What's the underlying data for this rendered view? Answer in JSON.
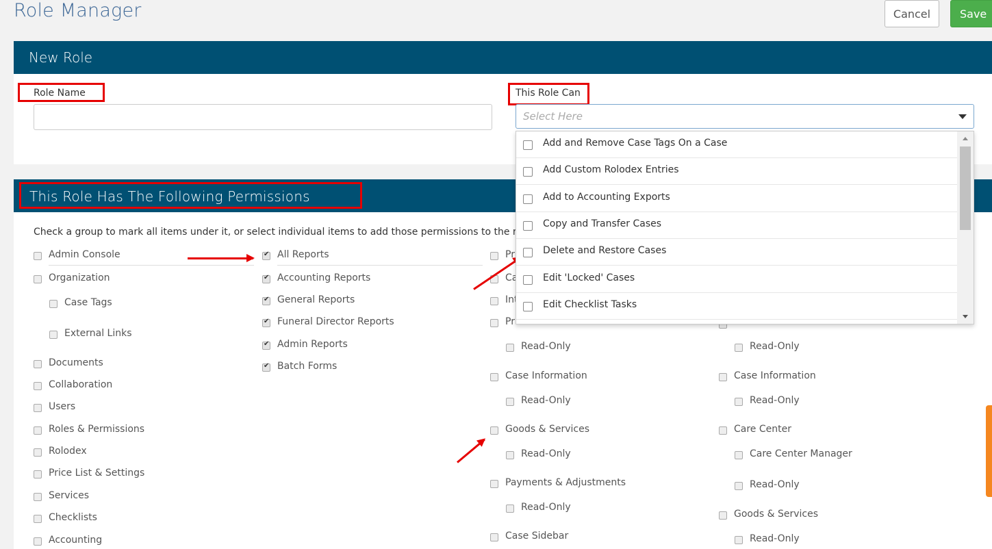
{
  "header": {
    "title": "Role Manager",
    "cancel_label": "Cancel",
    "save_label": "Save"
  },
  "new_role": {
    "heading": "New Role",
    "role_name_label": "Role Name",
    "role_name_value": "",
    "this_role_can_label": "This Role Can",
    "select_placeholder": "Select Here",
    "dropdown_options": [
      "Add and Remove Case Tags On a Case",
      "Add Custom Rolodex Entries",
      "Add to Accounting Exports",
      "Copy and Transfer Cases",
      "Delete and Restore Cases",
      "Edit 'Locked' Cases",
      "Edit Checklist Tasks"
    ]
  },
  "permissions": {
    "heading": "This Role Has The Following Permissions",
    "instructions": "Check a group to mark all items under it, or select individual items to add those permissions to the role.",
    "col1": [
      {
        "label": "Admin Console",
        "checked": false
      },
      {
        "label": "Organization",
        "checked": false
      },
      {
        "label": "Case Tags",
        "checked": false
      },
      {
        "label": "External Links",
        "checked": false
      },
      {
        "label": "Documents",
        "checked": false
      },
      {
        "label": "Collaboration",
        "checked": false
      },
      {
        "label": "Users",
        "checked": false
      },
      {
        "label": "Roles & Permissions",
        "checked": false
      },
      {
        "label": "Rolodex",
        "checked": false
      },
      {
        "label": "Price List & Settings",
        "checked": false
      },
      {
        "label": "Services",
        "checked": false
      },
      {
        "label": "Checklists",
        "checked": false
      },
      {
        "label": "Accounting",
        "checked": false
      }
    ],
    "col2": [
      {
        "label": "All Reports",
        "checked": true
      },
      {
        "label": "Accounting Reports",
        "checked": true
      },
      {
        "label": "General Reports",
        "checked": true
      },
      {
        "label": "Funeral Director Reports",
        "checked": true
      },
      {
        "label": "Admin Reports",
        "checked": true
      },
      {
        "label": "Batch Forms",
        "checked": true
      }
    ],
    "col3": [
      {
        "label": "Pr",
        "checked": false
      },
      {
        "label": "Ca",
        "checked": false
      },
      {
        "label": "Int",
        "checked": false
      },
      {
        "label": "Pr",
        "checked": false
      },
      {
        "label": "Read-Only",
        "checked": false
      },
      {
        "label": "Case Information",
        "checked": false
      },
      {
        "label": "Read-Only",
        "checked": false
      },
      {
        "label": "Goods & Services",
        "checked": false
      },
      {
        "label": "Read-Only",
        "checked": false
      },
      {
        "label": "Payments & Adjustments",
        "checked": false
      },
      {
        "label": "Read-Only",
        "checked": false
      },
      {
        "label": "Case Sidebar",
        "checked": false
      }
    ],
    "col4": [
      {
        "label": "Read-Only",
        "checked": false
      },
      {
        "label": "Case Information",
        "checked": false
      },
      {
        "label": "Read-Only",
        "checked": false
      },
      {
        "label": "Care Center",
        "checked": false
      },
      {
        "label": "Care Center Manager",
        "checked": false
      },
      {
        "label": "Read-Only",
        "checked": false
      },
      {
        "label": "Goods & Services",
        "checked": false
      },
      {
        "label": "Read-Only",
        "checked": false
      }
    ]
  },
  "colors": {
    "brand": "#005073",
    "title": "#3d6796",
    "save": "#4cae4c",
    "annotation": "#e60000",
    "side_tab": "#f5871f"
  }
}
